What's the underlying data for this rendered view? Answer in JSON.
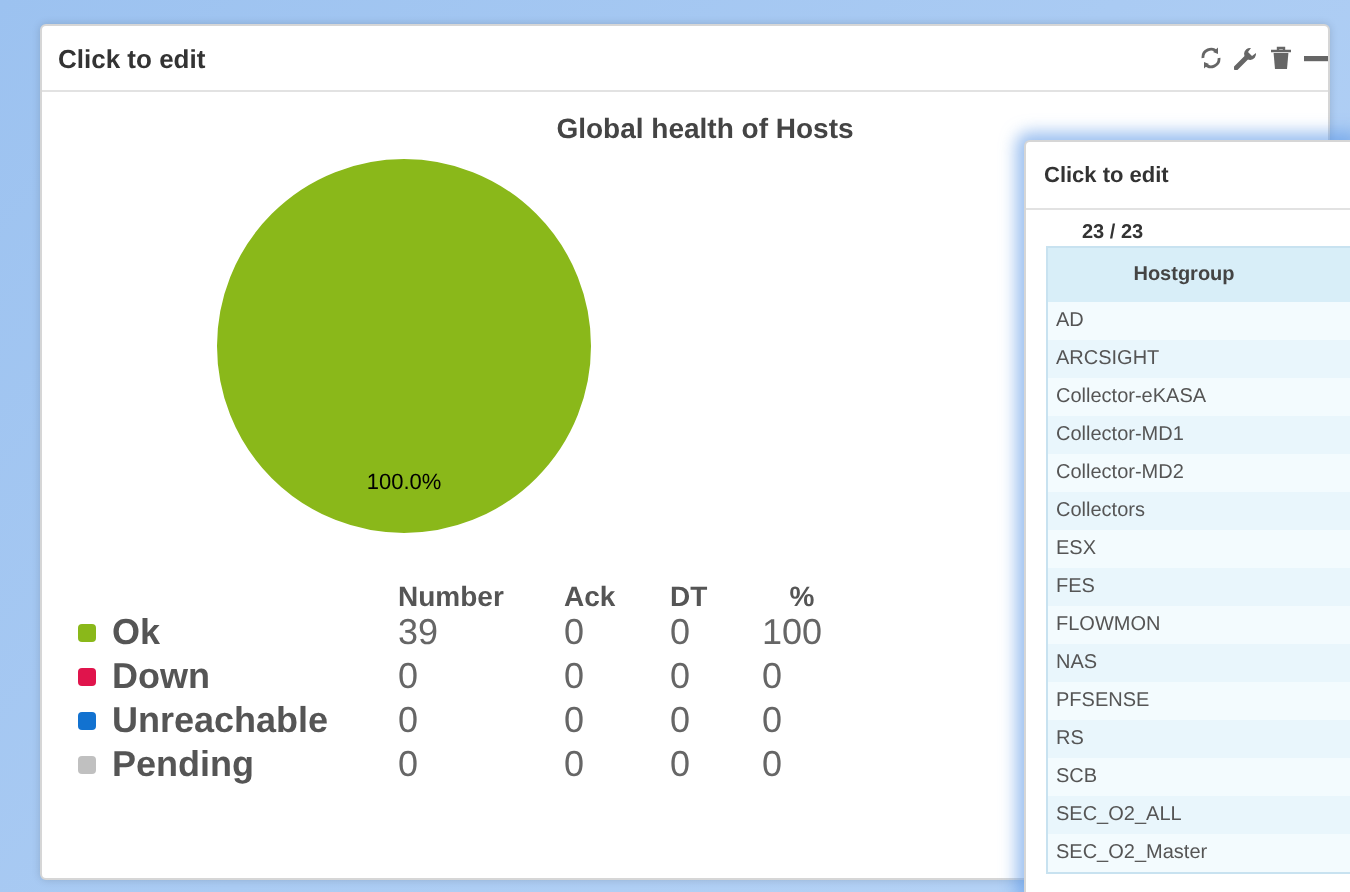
{
  "main_panel": {
    "title": "Click to edit",
    "chart": {
      "chart_data": {
        "type": "pie",
        "title": "Global health of Hosts",
        "series": [
          {
            "color": "#8ab81a",
            "values": [
              100
            ]
          }
        ],
        "value_labels": [
          "100.0%"
        ]
      }
    },
    "legend": {
      "columns": [
        "Number",
        "Ack",
        "DT",
        "%"
      ],
      "rows": [
        {
          "label": "Ok",
          "color": "#8ab81a",
          "cells": [
            "39",
            "0",
            "0",
            "100"
          ]
        },
        {
          "label": "Down",
          "color": "#e0144c",
          "cells": [
            "0",
            "0",
            "0",
            "0"
          ]
        },
        {
          "label": "Unreachable",
          "color": "#1272d0",
          "cells": [
            "0",
            "0",
            "0",
            "0"
          ]
        },
        {
          "label": "Pending",
          "color": "#c0c0c0",
          "cells": [
            "0",
            "0",
            "0",
            "0"
          ]
        }
      ]
    }
  },
  "hostgroup_panel": {
    "title": "Click to edit",
    "count": "23 / 23",
    "table": {
      "columns": [
        "Hostgroup"
      ],
      "rows": [
        "AD",
        "ARCSIGHT",
        "Collector-eKASA",
        "Collector-MD1",
        "Collector-MD2",
        "Collectors",
        "ESX",
        "FES",
        "FLOWMON",
        "NAS",
        "PFSENSE",
        "RS",
        "SCB",
        "SEC_O2_ALL",
        "SEC_O2_Master"
      ]
    }
  }
}
